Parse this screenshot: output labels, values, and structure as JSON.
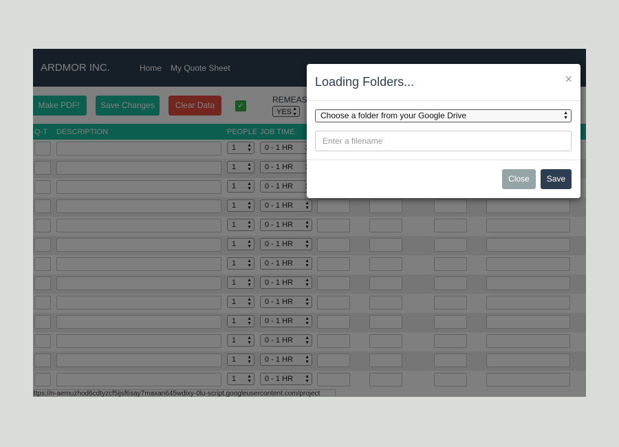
{
  "navbar": {
    "brand": "ARDMOR INC.",
    "links": [
      "Home",
      "My Quote Sheet"
    ]
  },
  "toolbar": {
    "make_pdf": "Make PDF!",
    "save_changes": "Save Changes",
    "clear_data": "Clear Data",
    "checkbox_checked": true,
    "remeasure_label": "REMEASU",
    "remeasure_value": "YES"
  },
  "table": {
    "headers": [
      "Q-T",
      "DESCRIPTION",
      "PEOPLE",
      "JOB TIME"
    ],
    "rows": [
      {
        "people": "1",
        "job_time": "0 - 1 HR"
      },
      {
        "people": "1",
        "job_time": "0 - 1 HR"
      },
      {
        "people": "1",
        "job_time": "0 - 1 HR"
      },
      {
        "people": "1",
        "job_time": "0 - 1 HR"
      },
      {
        "people": "1",
        "job_time": "0 - 1 HR"
      },
      {
        "people": "1",
        "job_time": "0 - 1 HR"
      },
      {
        "people": "1",
        "job_time": "0 - 1 HR"
      },
      {
        "people": "1",
        "job_time": "0 - 1 HR"
      },
      {
        "people": "1",
        "job_time": "0 - 1 HR"
      },
      {
        "people": "1",
        "job_time": "0 - 1 HR"
      },
      {
        "people": "1",
        "job_time": "0 - 1 HR"
      },
      {
        "people": "1",
        "job_time": "0 - 1 HR"
      },
      {
        "people": "1",
        "job_time": "0 - 1 HR"
      }
    ]
  },
  "status_url": "ttps://n-aemuzhod6cdtyzcf5ijsf6say7maxan645wdixy-0lu-script.googleusercontent.com/project",
  "modal": {
    "title": "Loading Folders...",
    "close_symbol": "×",
    "folder_select": "Choose a folder from your Google Drive",
    "filename_placeholder": "Enter a filename",
    "close_button": "Close",
    "save_button": "Save"
  },
  "colors": {
    "navbar": "#2c3e50",
    "teal": "#18bc9c",
    "red": "#e74c3c",
    "close_button": "#95a5a6",
    "save_button": "#2c3e50"
  }
}
